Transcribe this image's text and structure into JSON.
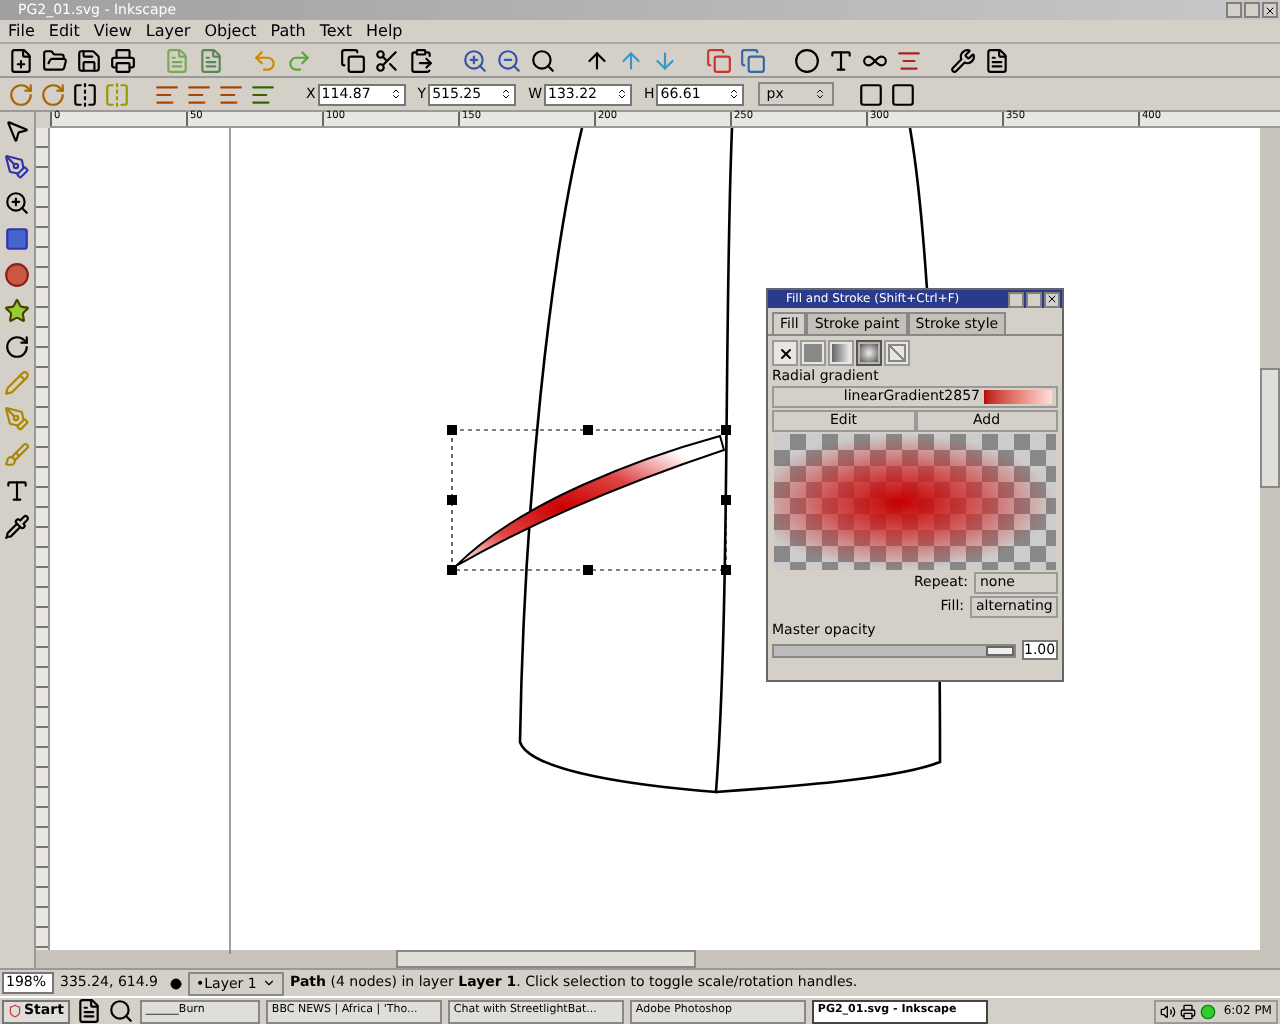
{
  "window": {
    "title": "PG2_01.svg - Inkscape"
  },
  "menu": [
    "File",
    "Edit",
    "View",
    "Layer",
    "Object",
    "Path",
    "Text",
    "Help"
  ],
  "coords": [
    {
      "label": "X",
      "value": "114.87"
    },
    {
      "label": "Y",
      "value": "515.25"
    },
    {
      "label": "W",
      "value": "133.22"
    },
    {
      "label": "H",
      "value": "66.61"
    }
  ],
  "unit": "px",
  "ruler": [
    "0",
    "50",
    "100",
    "150",
    "200",
    "250",
    "300",
    "350",
    "400"
  ],
  "dialog": {
    "title": "Fill and Stroke (Shift+Ctrl+F)",
    "tabs": [
      {
        "label": "Fill",
        "selected": true
      },
      {
        "label": "Stroke paint",
        "selected": false
      },
      {
        "label": "Stroke style",
        "selected": false
      }
    ],
    "paint_types": [
      {
        "kind": "none",
        "selected": false
      },
      {
        "kind": "flat",
        "selected": false
      },
      {
        "kind": "linear",
        "selected": false
      },
      {
        "kind": "radial",
        "selected": true
      },
      {
        "kind": "unset",
        "selected": false
      }
    ],
    "section": "Radial gradient",
    "gradient": "linearGradient2857",
    "buttons": [
      "Edit",
      "Add"
    ],
    "repeat": {
      "label": "Repeat:",
      "value": "none"
    },
    "fill": {
      "label": "Fill:",
      "value": "alternating"
    },
    "opacity": {
      "label": "Master opacity",
      "level": 1,
      "value": "1.00"
    }
  },
  "status": {
    "zoom": "198%",
    "cursor": "335.24, 614.9",
    "layer": "•Layer 1",
    "message": "**Path** (4 nodes) in layer **Layer 1**. Click selection to toggle scale/rotation handles."
  },
  "taskbar": {
    "start": "Start",
    "tasks": [
      {
        "label": "______Burn",
        "selected": false
      },
      {
        "label": "BBC NEWS | Africa | 'Tho...",
        "selected": false
      },
      {
        "label": "Chat with StreetlightBat...",
        "selected": false
      },
      {
        "label": "Adobe Photoshop",
        "selected": false
      },
      {
        "label": "PG2_01.svg - Inkscape",
        "selected": true
      }
    ],
    "clock": "6:02 PM"
  }
}
